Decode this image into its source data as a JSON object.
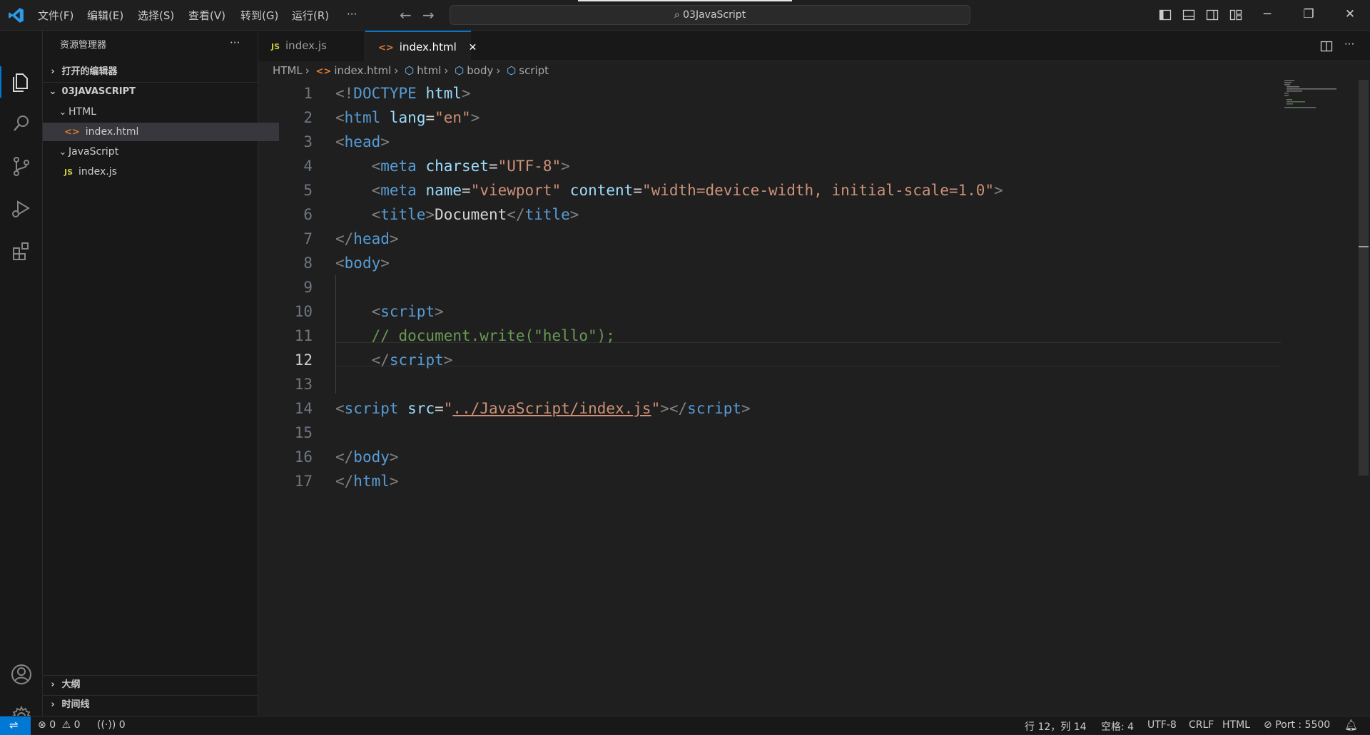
{
  "menu": [
    "文件(F)",
    "编辑(E)",
    "选择(S)",
    "查看(V)",
    "转到(G)",
    "运行(R)",
    "···"
  ],
  "command_center": "03JavaScript",
  "sidebar": {
    "title": "资源管理器",
    "more": "···",
    "open_editors": "打开的编辑器",
    "root": "03JAVASCRIPT",
    "folders": [
      {
        "name": "HTML",
        "files": [
          {
            "name": "index.html",
            "badge": "<>",
            "selected": true
          }
        ]
      },
      {
        "name": "JavaScript",
        "files": [
          {
            "name": "index.js",
            "badge": "JS",
            "selected": false
          }
        ]
      }
    ],
    "outline": "大纲",
    "timeline": "时间线"
  },
  "tabs": [
    {
      "label": "index.js",
      "badge": "JS",
      "active": false
    },
    {
      "label": "index.html",
      "badge": "<>",
      "active": true,
      "close": "✕"
    }
  ],
  "breadcrumb": [
    "HTML",
    "index.html",
    "html",
    "body",
    "script"
  ],
  "editor": {
    "active_line": 12,
    "lines": [
      {
        "n": "1",
        "tokens": [
          [
            "p",
            "<!"
          ],
          [
            "k",
            "DOCTYPE"
          ],
          [
            "t",
            " "
          ],
          [
            "a",
            "html"
          ],
          [
            "p",
            ">"
          ]
        ]
      },
      {
        "n": "2",
        "tokens": [
          [
            "p",
            "<"
          ],
          [
            "k",
            "html"
          ],
          [
            "t",
            " "
          ],
          [
            "a",
            "lang"
          ],
          [
            "t",
            "="
          ],
          [
            "s",
            "\"en\""
          ],
          [
            "p",
            ">"
          ]
        ]
      },
      {
        "n": "3",
        "tokens": [
          [
            "p",
            "<"
          ],
          [
            "k",
            "head"
          ],
          [
            "p",
            ">"
          ]
        ]
      },
      {
        "n": "4",
        "tokens": [
          [
            "t",
            "    "
          ],
          [
            "p",
            "<"
          ],
          [
            "k",
            "meta"
          ],
          [
            "t",
            " "
          ],
          [
            "a",
            "charset"
          ],
          [
            "t",
            "="
          ],
          [
            "s",
            "\"UTF-8\""
          ],
          [
            "p",
            ">"
          ]
        ]
      },
      {
        "n": "5",
        "tokens": [
          [
            "t",
            "    "
          ],
          [
            "p",
            "<"
          ],
          [
            "k",
            "meta"
          ],
          [
            "t",
            " "
          ],
          [
            "a",
            "name"
          ],
          [
            "t",
            "="
          ],
          [
            "s",
            "\"viewport\""
          ],
          [
            "t",
            " "
          ],
          [
            "a",
            "content"
          ],
          [
            "t",
            "="
          ],
          [
            "s",
            "\"width=device-width, initial-scale=1.0\""
          ],
          [
            "p",
            ">"
          ]
        ]
      },
      {
        "n": "6",
        "tokens": [
          [
            "t",
            "    "
          ],
          [
            "p",
            "<"
          ],
          [
            "k",
            "title"
          ],
          [
            "p",
            ">"
          ],
          [
            "t",
            "Document"
          ],
          [
            "p",
            "</"
          ],
          [
            "k",
            "title"
          ],
          [
            "p",
            ">"
          ]
        ]
      },
      {
        "n": "7",
        "tokens": [
          [
            "p",
            "</"
          ],
          [
            "k",
            "head"
          ],
          [
            "p",
            ">"
          ]
        ]
      },
      {
        "n": "8",
        "tokens": [
          [
            "p",
            "<"
          ],
          [
            "k",
            "body"
          ],
          [
            "p",
            ">"
          ]
        ]
      },
      {
        "n": "9",
        "tokens": []
      },
      {
        "n": "10",
        "tokens": [
          [
            "t",
            "    "
          ],
          [
            "p",
            "<"
          ],
          [
            "k",
            "script"
          ],
          [
            "p",
            ">"
          ]
        ]
      },
      {
        "n": "11",
        "tokens": [
          [
            "t",
            "    "
          ],
          [
            "c",
            "// document.write(\"hello\");"
          ]
        ]
      },
      {
        "n": "12",
        "tokens": [
          [
            "t",
            "    "
          ],
          [
            "p",
            "</"
          ],
          [
            "k",
            "script"
          ],
          [
            "p",
            ">"
          ]
        ]
      },
      {
        "n": "13",
        "tokens": []
      },
      {
        "n": "14",
        "tokens": [
          [
            "p",
            "<"
          ],
          [
            "k",
            "script"
          ],
          [
            "t",
            " "
          ],
          [
            "a",
            "src"
          ],
          [
            "t",
            "="
          ],
          [
            "s",
            "\""
          ],
          [
            "u",
            "../JavaScript/index.js"
          ],
          [
            "s",
            "\""
          ],
          [
            "p",
            "></"
          ],
          [
            "k",
            "script"
          ],
          [
            "p",
            ">"
          ]
        ]
      },
      {
        "n": "15",
        "tokens": []
      },
      {
        "n": "16",
        "tokens": [
          [
            "p",
            "</"
          ],
          [
            "k",
            "body"
          ],
          [
            "p",
            ">"
          ]
        ]
      },
      {
        "n": "17",
        "tokens": [
          [
            "p",
            "</"
          ],
          [
            "k",
            "html"
          ],
          [
            "p",
            ">"
          ]
        ]
      }
    ]
  },
  "status": {
    "errors": "0",
    "warnings": "0",
    "ports": "0",
    "position": "行 12，列 14",
    "spaces": "空格: 4",
    "encoding": "UTF-8",
    "eol": "CRLF",
    "language": "HTML",
    "port": "Port : 5500"
  },
  "colors": {
    "accent": "#0078d4",
    "tag": "#569cd6",
    "attr": "#9cdcfe",
    "string": "#ce9178",
    "comment": "#6a9955"
  }
}
